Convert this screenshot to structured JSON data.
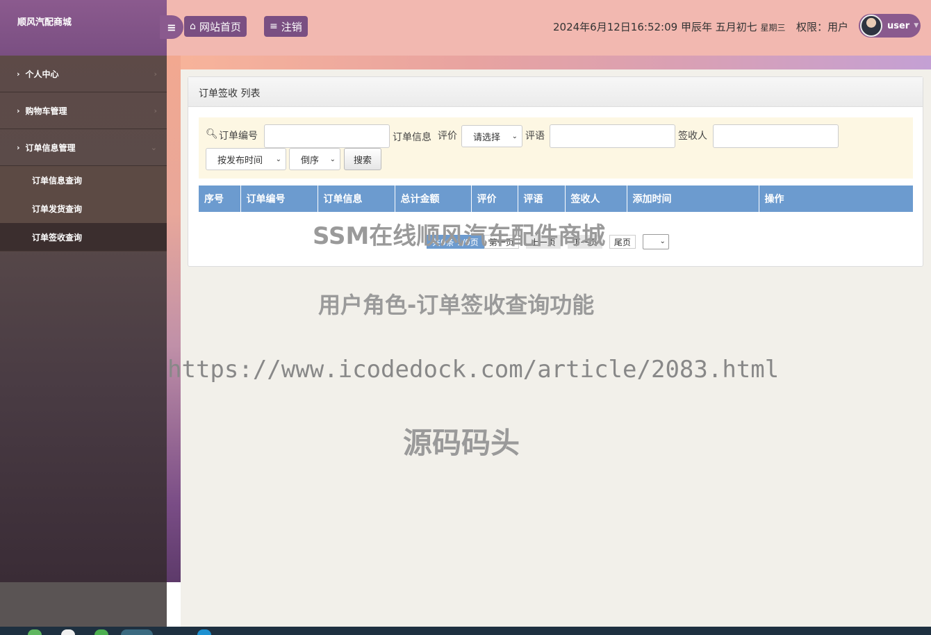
{
  "brand": "顺风汽配商城",
  "header": {
    "home_label": "网站首页",
    "logout_label": "注销",
    "datetime": "2024年6月12日16:52:09 甲辰年 五月初七",
    "weekday": "星期三",
    "permission": "权限：用户",
    "username": "user"
  },
  "sidebar": {
    "items": [
      {
        "label": "个人中心"
      },
      {
        "label": "购物车管理"
      },
      {
        "label": "订单信息管理"
      }
    ],
    "subitems": [
      {
        "label": "订单信息查询"
      },
      {
        "label": "订单发货查询"
      },
      {
        "label": "订单签收查询"
      }
    ]
  },
  "panel": {
    "title": "订单签收 列表"
  },
  "search": {
    "order_no_label": "订单编号",
    "order_info_label": "订单信息",
    "rating_label": "评价",
    "rating_select": "请选择",
    "comment_label": "评语",
    "receiver_label": "签收人",
    "sort_select": "按发布时间",
    "order_select": "倒序",
    "search_button": "搜索"
  },
  "table": {
    "columns": [
      "序号",
      "订单编号",
      "订单信息",
      "总计金额",
      "评价",
      "评语",
      "签收人",
      "添加时间",
      "操作"
    ]
  },
  "pager": {
    "info": "共0条  1/0页",
    "first": "第一页",
    "prev": "上一页",
    "next": "下一页",
    "last": "尾页"
  },
  "watermarks": {
    "line1": "SSM在线顺风汽车配件商城",
    "line2": "用户角色-订单签收查询功能",
    "line3": "https://www.icodedock.com/article/2083.html",
    "line4": "源码码头"
  }
}
